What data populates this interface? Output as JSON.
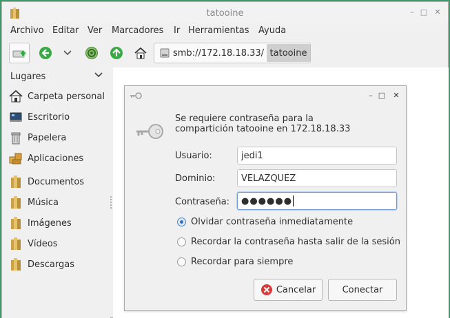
{
  "window": {
    "title": "tatooine"
  },
  "menu": [
    "Archivo",
    "Editar",
    "Ver",
    "Marcadores",
    "Ir",
    "Herramientas",
    "Ayuda"
  ],
  "toolbar": {
    "path_text": "smb://172.18.18.33/",
    "path_current": "tatooine"
  },
  "sidebar": {
    "header": "Lugares",
    "items": [
      {
        "label": "Carpeta personal",
        "icon": "home-icon"
      },
      {
        "label": "Escritorio",
        "icon": "desktop-icon"
      },
      {
        "label": "Papelera",
        "icon": "trash-icon"
      },
      {
        "label": "Aplicaciones",
        "icon": "applications-icon"
      },
      {
        "label": "Documentos",
        "icon": "folder-icon"
      },
      {
        "label": "Música",
        "icon": "folder-icon"
      },
      {
        "label": "Imágenes",
        "icon": "folder-icon"
      },
      {
        "label": "Vídeos",
        "icon": "folder-icon"
      },
      {
        "label": "Descargas",
        "icon": "folder-icon"
      }
    ]
  },
  "dialog": {
    "message_line1": "Se requiere contraseña para la",
    "message_line2": "compartición tatooine en 172.18.18.33",
    "user_label": "Usuario:",
    "user_value": "jedi1",
    "domain_label": "Dominio:",
    "domain_value": "VELAZQUEZ",
    "password_label": "Contraseña:",
    "password_value": "●●●●●●",
    "radios": [
      {
        "label": "Olvidar contraseña inmediatamente",
        "selected": true
      },
      {
        "label": "Recordar la contraseña hasta salir de la sesión",
        "selected": false
      },
      {
        "label": "Recordar para siempre",
        "selected": false
      }
    ],
    "cancel_label": "Cancelar",
    "connect_label": "Conectar"
  },
  "colors": {
    "desktop": "#3c9a6a",
    "accent": "#3a73b8",
    "cancel_icon": "#d93a3a",
    "nav_green": "#3aa845"
  }
}
